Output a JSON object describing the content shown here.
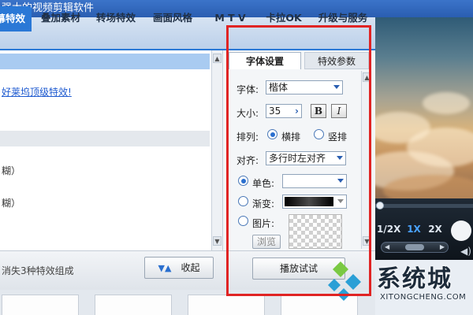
{
  "window": {
    "title": "强大的视频剪辑软件"
  },
  "tabs": [
    {
      "label": "字幕特效",
      "active": true
    },
    {
      "label": "叠加素材",
      "active": false
    },
    {
      "label": "转场特效",
      "active": false
    },
    {
      "label": "画面风格",
      "active": false
    },
    {
      "label": "M T V",
      "active": false
    },
    {
      "label": "卡拉OK",
      "active": false
    },
    {
      "label": "升级与服务",
      "active": false
    }
  ],
  "effect_list": {
    "link_text": "好莱坞顶级特效!",
    "row3": "糊）",
    "row4": "糊）"
  },
  "panel": {
    "tabs": [
      {
        "label": "字体设置",
        "active": true
      },
      {
        "label": "特效参数",
        "active": false
      }
    ],
    "font": {
      "label": "字体:",
      "value": "楷体"
    },
    "size": {
      "label": "大小:",
      "value": "35"
    },
    "bold_label": "B",
    "italic_label": "I",
    "arrange": {
      "label": "排列:",
      "options": [
        "横排",
        "竖排"
      ],
      "selected": 0
    },
    "align": {
      "label": "对齐:",
      "value": "多行时左对齐"
    },
    "fill": {
      "solid_label": "单色:",
      "gradient_label": "渐变:",
      "image_label": "图片:",
      "selected": 0
    },
    "browse_label": "浏览",
    "preview_button": "播放试试"
  },
  "bottom": {
    "status_text": "消失3种特效组成",
    "collapse_button": "收起"
  },
  "player": {
    "speeds": [
      {
        "label": "1/2X",
        "active": false
      },
      {
        "label": "1X",
        "active": true
      },
      {
        "label": "2X",
        "active": false
      }
    ]
  },
  "watermark": {
    "text": "系统城",
    "url": "XITONGCHENG.COM"
  },
  "colors": {
    "accent": "#2a78d6",
    "highlight": "#e02424",
    "link": "#1f5bd0"
  }
}
